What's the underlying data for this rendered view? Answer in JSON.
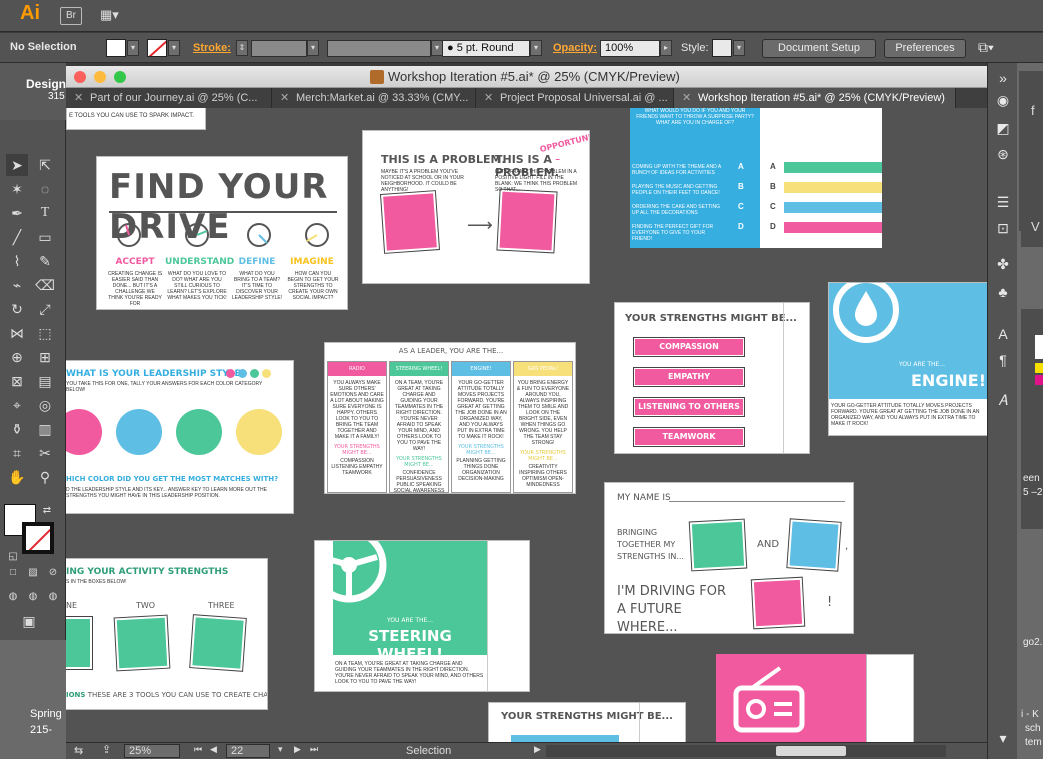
{
  "app": {
    "logo": "Ai",
    "bridge": "Br",
    "workspace_icon": "▦▾"
  },
  "control_bar": {
    "selection": "No Selection",
    "stroke_label": "Stroke:",
    "brush_value": "5 pt. Round",
    "opacity_label": "Opacity:",
    "opacity_value": "100%",
    "style_label": "Style:",
    "document_setup": "Document Setup",
    "preferences": "Preferences"
  },
  "desktop": {
    "top_left_text": "Design",
    "top_left_sub": "315",
    "bottom_left_text": "Spring",
    "bottom_left_sub": "215-",
    "right_fragments": [
      "een",
      "5 –2",
      "go2.",
      "i - K",
      "sch",
      "tem"
    ]
  },
  "window": {
    "title": "Workshop Iteration #5.ai* @ 25% (CMYK/Preview)"
  },
  "tabs": [
    {
      "label": "Part of our Journey.ai @ 25% (C..."
    },
    {
      "label": "Merch:Market.ai @ 33.33% (CMY..."
    },
    {
      "label": "Project Proposal Universal.ai @ ..."
    },
    {
      "label": "Workshop Iteration #5.ai* @ 25% (CMYK/Preview)"
    }
  ],
  "colors": {
    "pink": "#f15a9f",
    "teal": "#4cc79a",
    "blue": "#5ebee3",
    "yellow": "#f7e07a",
    "ui_orange": "#ffa733"
  },
  "artboards": {
    "top_strip_text": "E TOOLS YOU CAN USE TO SPARK IMPACT.",
    "find_drive": {
      "title": "FIND YOUR DRIVE",
      "steps": [
        {
          "name": "ACCEPT",
          "text": "CREATING CHANGE IS EASIER SAID THAN DONE... BUT IT'S A CHALLENGE WE THINK YOU'RE READY FOR"
        },
        {
          "name": "UNDERSTAND",
          "text": "WHAT DO YOU LOVE TO DO? WHAT ARE YOU STILL CURIOUS TO LEARN? LET'S EXPLORE WHAT MAKES YOU TICK!"
        },
        {
          "name": "DEFINE",
          "text": "WHAT DO YOU BRING TO A TEAM? IT'S TIME TO DISCOVER YOUR LEADERSHIP STYLE!"
        },
        {
          "name": "IMAGINE",
          "text": "HOW CAN YOU BEGIN TO GET YOUR STRENGTHS TO CREATE YOUR OWN SOCIAL IMPACT?"
        }
      ]
    },
    "problem": {
      "left": "THIS IS A PROBLEM.",
      "right_prefix": "THIS IS A",
      "right_suffix": "PROBLEM.",
      "opportunity": "OPPORTUNITY!",
      "left_text": "MAYBE IT'S A PROBLEM YOU'VE NOTICED AT SCHOOL OR IN YOUR NEIGHBORHOOD. IT COULD BE ANYTHING!",
      "right_text": "LET'S FRAME THIS PROBLEM IN A POSITIVE LIGHT. FILL IN THE BLANK: WE THINK THIS PROBLEM SO THAT..."
    },
    "quiz": {
      "header_text": "WHAT WOULD YOU DO IF YOU AND YOUR FRIENDS WANT TO THROW A SURPRISE PARTY? WHAT ARE YOU IN CHARGE OF?",
      "options": [
        {
          "letter": "A",
          "text": "COMING UP WITH THE THEME AND A BUNCH OF IDEAS FOR ACTIVITIES"
        },
        {
          "letter": "B",
          "text": "PLAYING THE MUSIC AND GETTING PEOPLE ON THEIR FEET TO DANCE!"
        },
        {
          "letter": "C",
          "text": "ORDERING THE CAKE AND SETTING UP ALL THE DECORATIONS"
        },
        {
          "letter": "D",
          "text": "FINDING THE PERFECT GIFT FOR EVERYONE TO GIVE TO YOUR FRIEND!"
        }
      ]
    },
    "strengths": {
      "title": "YOUR STRENGTHS MIGHT BE...",
      "items": [
        "COMPASSION",
        "EMPATHY",
        "LISTENING TO OTHERS",
        "TEAMWORK"
      ]
    },
    "engine": {
      "you_are": "YOU ARE THE...",
      "name": "ENGINE!",
      "text": "YOUR GO-GETTER ATTITUDE TOTALLY MOVES PROJECTS FORWARD. YOU'RE GREAT AT GETTING THE JOB DONE IN AN ORGANIZED WAY, AND YOU ALWAYS PUT IN EXTRA TIME TO MAKE IT ROCK!"
    },
    "leadership": {
      "title": "WHAT IS YOUR LEADERSHIP STYLE?",
      "subtitle": "YOU TAKE THIS FOR ONE, TALLY YOUR ANSWERS FOR EACH COLOR CATEGORY BELOW!",
      "question": "HICH COLOR DID YOU GET THE MOST MATCHES WITH?",
      "bottom": "D THE LEADERSHIP STYLE AND ITS KEY... ANSWER KEY TO LEARN MORE OUT THE STRENGTHS YOU MIGHT HAVE IN THIS LEADERSHIP POSITION."
    },
    "as_leader": {
      "title": "AS A LEADER, YOU ARE THE...",
      "columns": [
        {
          "name": "RADIO",
          "strengths": "YOUR STRENGTHS MIGHT BE...",
          "list": "COMPASSION LISTENING EMPATHY TEAMWORK",
          "body": "YOU ALWAYS MAKE SURE OTHERS' EMOTIONS AND CARE A LOT ABOUT MAKING SURE EVERYONE IS HAPPY. OTHERS LOOK TO YOU TO BRING THE TEAM TOGETHER AND MAKE IT A FAMILY!"
        },
        {
          "name": "STEERING WHEEL!",
          "strengths": "YOUR STRENGTHS MIGHT BE...",
          "list": "CONFIDENCE PERSUASIVENESS PUBLIC SPEAKING SOCIAL AWARENESS",
          "body": "ON A TEAM, YOU'RE GREAT AT TAKING CHARGE AND GUIDING YOUR TEAMMATES IN THE RIGHT DIRECTION. YOU'RE NEVER AFRAID TO SPEAK YOUR MIND, AND OTHERS LOOK TO YOU TO PAVE THE WAY!"
        },
        {
          "name": "ENGINE!",
          "strengths": "YOUR STRENGTHS MIGHT BE...",
          "list": "PLANNING GETTING THINGS DONE ORGANIZATION DECISION-MAKING",
          "body": "YOUR GO-GETTER ATTITUDE TOTALLY MOVES PROJECTS FORWARD. YOU'RE GREAT AT GETTING THE JOB DONE IN AN ORGANIZED WAY, AND YOU ALWAYS PUT IN EXTRA TIME TO MAKE IT ROCK!"
        },
        {
          "name": "GAS PEDAL!",
          "strengths": "YOUR STRENGTHS MIGHT BE...",
          "list": "CREATIVITY INSPIRING OTHERS OPTIMISM OPEN-MINDEDNESS",
          "body": "YOU BRING ENERGY & FUN TO EVERYONE AROUND YOU, ALWAYS INSPIRING THEM TO SMILE AND LOOK ON THE BRIGHT SIDE, EVEN WHEN THINGS GO WRONG. YOU HELP THE TEAM STAY STRONG!"
        }
      ]
    },
    "my_name": {
      "label": "MY NAME IS",
      "bringing": "BRINGING TOGETHER MY STRENGTHS IN...",
      "and": "AND",
      "comma": ",",
      "driving": "I'M DRIVING FOR A FUTURE WHERE...",
      "excl": "!"
    },
    "activity": {
      "title": "ING YOUR ACTIVITY STRENGTHS",
      "subtitle": "S IN THE BOXES BELOW!",
      "labels": [
        "NE",
        "TWO",
        "THREE"
      ],
      "bottom_prefix": "IONS",
      "bottom": "THESE ARE 3 TOOLS YOU CAN USE TO CREATE CHANGE."
    },
    "steering": {
      "you_are": "YOU ARE THE...",
      "name": "STEERING WHEEL!",
      "text": "ON A TEAM, YOU'RE GREAT AT TAKING CHARGE AND GUIDING YOUR TEAMMATES IN THE RIGHT DIRECTION. YOU'RE NEVER AFRAID TO SPEAK YOUR MIND, AND OTHERS LOOK TO YOU TO PAVE THE WAY!"
    },
    "strengths_bottom": {
      "title": "YOUR STRENGTHS MIGHT BE..."
    }
  },
  "status_bar": {
    "zoom": "25%",
    "page": "22",
    "mode": "Selection"
  }
}
